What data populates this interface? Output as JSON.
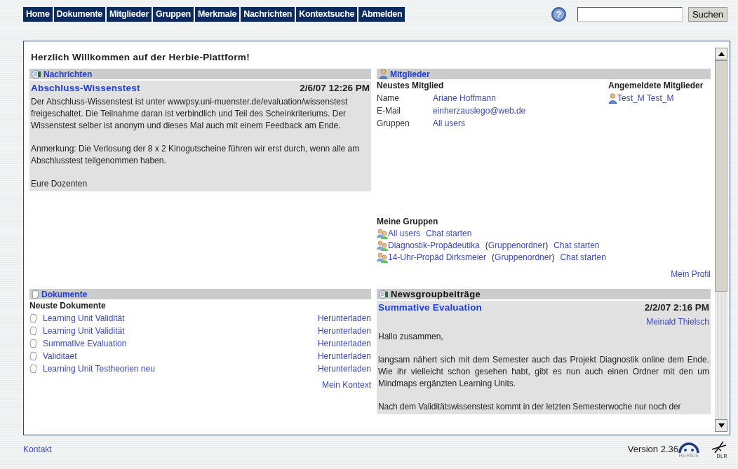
{
  "nav": {
    "tabs": [
      {
        "label": "Home",
        "selected": false
      },
      {
        "label": "Dokumente",
        "selected": false
      },
      {
        "label": "Mitglieder",
        "selected": false
      },
      {
        "label": "Gruppen",
        "selected": false
      },
      {
        "label": "Merkmale",
        "selected": false
      },
      {
        "label": "Nachrichten",
        "selected": false
      },
      {
        "label": "Kontextsuche",
        "selected": false
      },
      {
        "label": "Abmelden",
        "selected": false
      }
    ],
    "help": "?",
    "search": {
      "button": "Suchen"
    }
  },
  "welcome": "Herzlich Willkommen auf der Herbie-Plattform!",
  "news": {
    "header": "Nachrichten",
    "title": "Abschluss-Wissenstest",
    "date": "2/6/07 12:26 PM",
    "paragraphs": [
      "Der Abschluss-Wissenstest ist unter wwwpsy.uni-muenster.de/evaluation/wissenstest freigeschaltet. Die Teilnahme daran ist verbindlich und Teil des Scheinkriteriums. Der Wissenstest selber ist anonym und dieses Mal auch mit einem Feedback am Ende.",
      "Anmerkung: Die Verlosung der 8 x 2 Kinogutscheine führen wir erst durch, wenn alle am Abschlusstest teilgenommen haben.",
      "Eure Dozenten"
    ]
  },
  "members": {
    "header": "Mitglieder",
    "newest_heading": "Neustes Mitglied",
    "fields": [
      {
        "label": "Name",
        "value": "Ariane Hoffmann"
      },
      {
        "label": "E-Mail",
        "value": "einherzauslego@web.de"
      },
      {
        "label": "Gruppen",
        "value": "All users"
      }
    ],
    "online_heading": "Angemeldete Mitglieder",
    "online": [
      "Test_M Test_M"
    ],
    "groups_heading": "Meine Gruppen",
    "groups": [
      {
        "name": "All users",
        "chat": "Chat starten"
      },
      {
        "name": "Diagnostik-Propädeutika",
        "open": "(",
        "folder": "Gruppenordner",
        "close": ")",
        "chat": "Chat starten"
      },
      {
        "name": "14-Uhr-Propäd Dirksmeier",
        "open": "(",
        "folder": "Gruppenordner",
        "close": ")",
        "chat": "Chat starten"
      }
    ],
    "profile_link": "Mein Profil"
  },
  "documents": {
    "header": "Dokumente",
    "heading": "Neuste Dokumente",
    "items": [
      {
        "name": "Learning Unit Validität",
        "action": "Herunterladen"
      },
      {
        "name": "Learning Unit Validität",
        "action": "Herunterladen"
      },
      {
        "name": "Summative Evaluation",
        "action": "Herunterladen"
      },
      {
        "name": "Validitaet",
        "action": "Herunterladen"
      },
      {
        "name": "Learning Unit Testheorien neu",
        "action": "Herunterladen"
      }
    ],
    "context_link": "Mein Kontext"
  },
  "newsgroup": {
    "header": "Newsgroupbeiträge",
    "title": "Summative Evaluation",
    "date": "2/2/07 2:16 PM",
    "author": "Meinald Thielsch",
    "paragraphs": [
      "Hallo zusammen,",
      "langsam nähert sich mit dem Semester auch das Projekt Diagnostik online dem Ende. Wie ihr vielleicht schon gesehen habt, gibt es nun auch einen Ordner mit den um Mindmaps ergänzten Learning Units.",
      "Nach dem Validitätswissenstest kommt in der letzten Semesterwoche nur noch der"
    ]
  },
  "footer": {
    "contact": "Kontakt",
    "version": "Version 2.36",
    "herbie_logo": "HERBIE",
    "dlr_logo": "DLR"
  }
}
